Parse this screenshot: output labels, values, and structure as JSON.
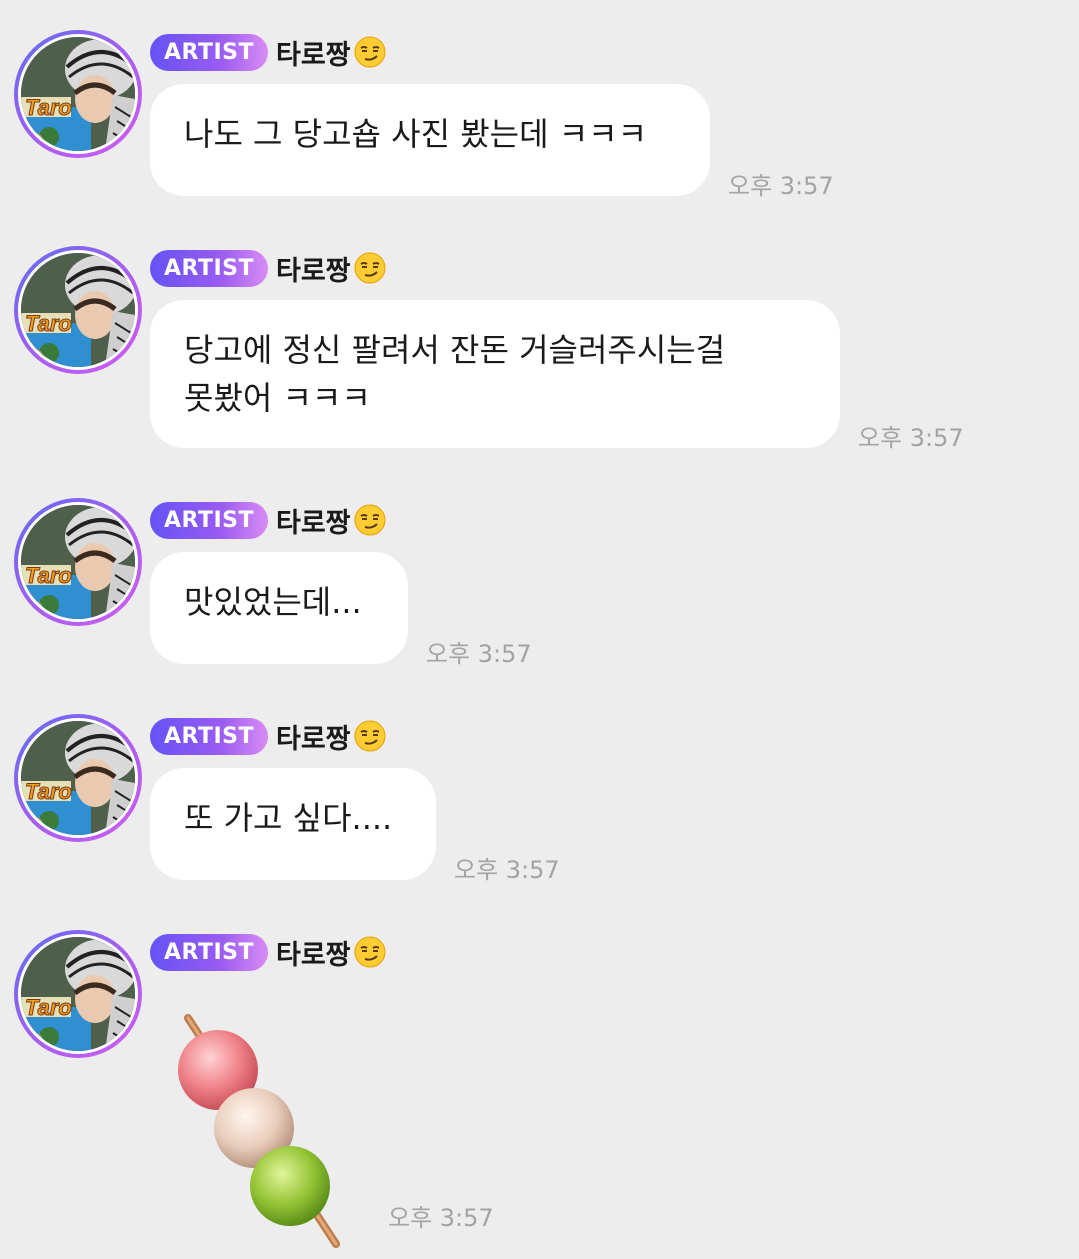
{
  "messages": [
    {
      "badge": "ARTIST",
      "sender": "타로짱",
      "sender_emoji": "smirking-face-icon",
      "text": "나도 그 당고숍 사진 봤는데 ㅋㅋㅋ",
      "time": "오후 3:57"
    },
    {
      "badge": "ARTIST",
      "sender": "타로짱",
      "sender_emoji": "smirking-face-icon",
      "text": "당고에 정신 팔려서 잔돈 거슬러주시는걸\n못봤어 ㅋㅋㅋ",
      "time": "오후 3:57"
    },
    {
      "badge": "ARTIST",
      "sender": "타로짱",
      "sender_emoji": "smirking-face-icon",
      "text": "맛있었는데...",
      "time": "오후 3:57"
    },
    {
      "badge": "ARTIST",
      "sender": "타로짱",
      "sender_emoji": "smirking-face-icon",
      "text": "또 가고 싶다....",
      "time": "오후 3:57"
    },
    {
      "badge": "ARTIST",
      "sender": "타로짱",
      "sender_emoji": "smirking-face-icon",
      "sticker": "dango-icon",
      "time": "오후 3:57"
    }
  ],
  "colors": {
    "background": "#ededed",
    "bubble": "#ffffff",
    "badge_start": "#6552f5",
    "badge_end": "#d98cf4",
    "time": "#a3a3a3"
  }
}
